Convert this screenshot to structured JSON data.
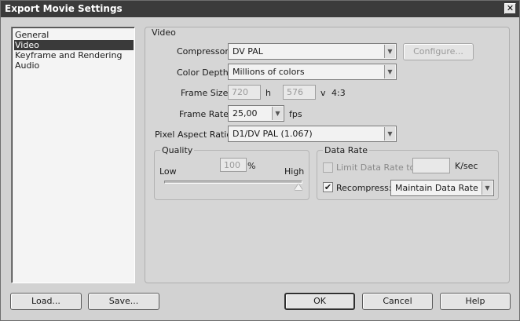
{
  "window": {
    "title": "Export Movie Settings",
    "close_glyph": "✕"
  },
  "sidebar": {
    "items": [
      {
        "label": "General",
        "selected": false
      },
      {
        "label": "Video",
        "selected": true
      },
      {
        "label": "Keyframe and Rendering",
        "selected": false
      },
      {
        "label": "Audio",
        "selected": false
      }
    ]
  },
  "video": {
    "group_label": "Video",
    "compressor_label": "Compressor:",
    "compressor_value": "DV PAL",
    "configure_label": "Configure...",
    "color_depth_label": "Color Depth:",
    "color_depth_value": "Millions of colors",
    "frame_size_label": "Frame Size:",
    "frame_width": "720",
    "frame_h_label": "h",
    "frame_height": "576",
    "frame_v_label": "v",
    "aspect": "4:3",
    "frame_rate_label": "Frame Rate:",
    "frame_rate_value": "25,00",
    "fps_label": "fps",
    "pixel_aspect_label": "Pixel Aspect Ratio:",
    "pixel_aspect_value": "D1/DV PAL (1.067)"
  },
  "quality": {
    "group_label": "Quality",
    "low_label": "Low",
    "high_label": "High",
    "value": "100",
    "percent_label": "%",
    "level": 1.0
  },
  "data_rate": {
    "group_label": "Data Rate",
    "limit_label": "Limit Data Rate to:",
    "limit_checked": false,
    "limit_value": "",
    "unit_label": "K/sec",
    "recompress_label": "Recompress:",
    "recompress_checked": true,
    "recompress_value": "Maintain Data Rate",
    "check_glyph": "✔"
  },
  "footer": {
    "load_label": "Load...",
    "save_label": "Save...",
    "ok_label": "OK",
    "cancel_label": "Cancel",
    "help_label": "Help"
  },
  "icons": {
    "dropdown": "▼"
  }
}
